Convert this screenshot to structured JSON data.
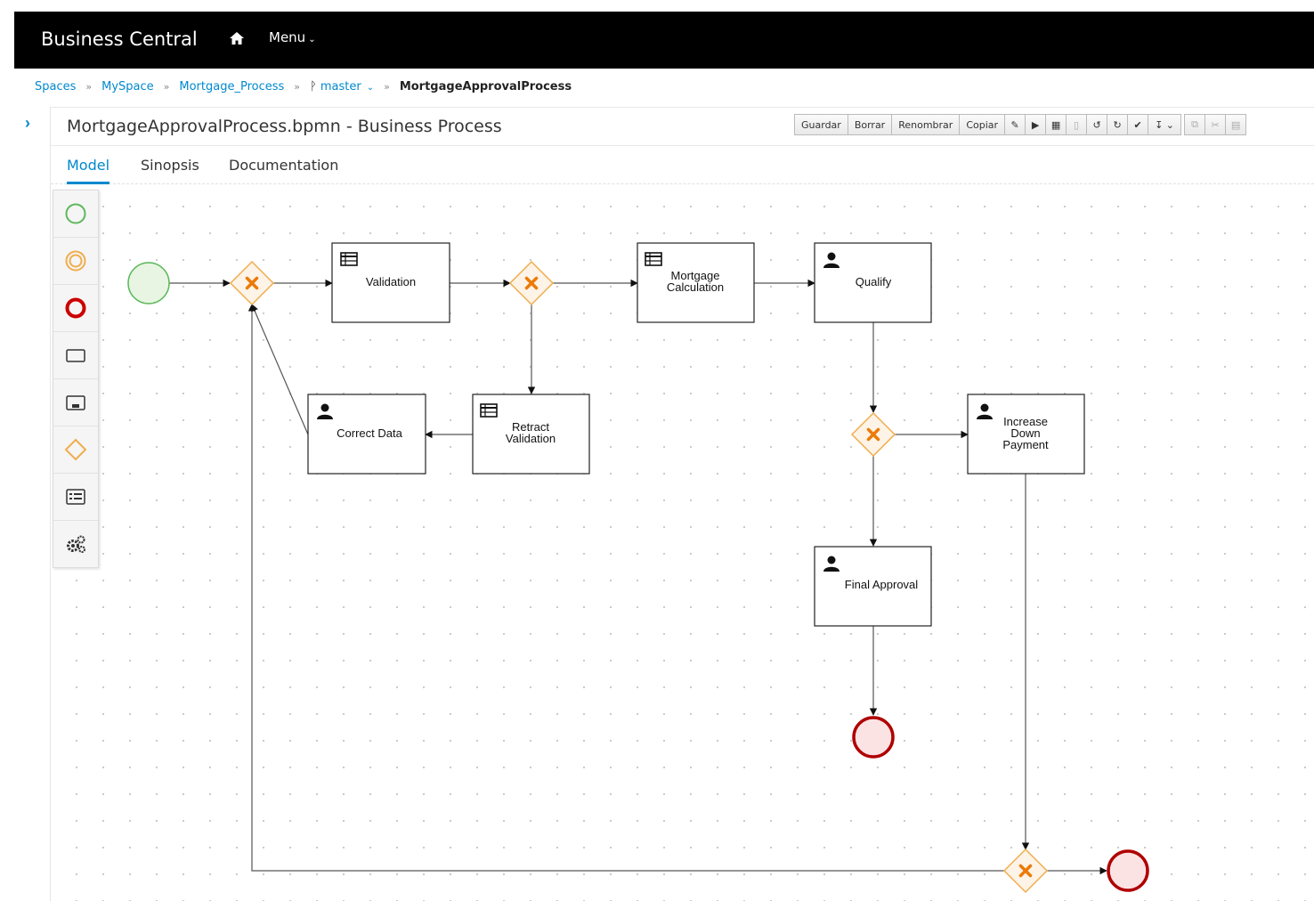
{
  "app": {
    "brand": "Business Central",
    "menu_label": "Menu"
  },
  "breadcrumb": {
    "items": [
      "Spaces",
      "MySpace",
      "Mortgage_Process"
    ],
    "branch": "master",
    "current": "MortgageApprovalProcess"
  },
  "editor": {
    "title": "MortgageApprovalProcess.bpmn - Business Process",
    "toolbar": {
      "save": "Guardar",
      "delete": "Borrar",
      "rename": "Renombrar",
      "copy": "Copiar"
    },
    "tabs": [
      "Model",
      "Sinopsis",
      "Documentation"
    ],
    "active_tab": "Model"
  },
  "palette": {
    "items": [
      "start-events",
      "intermediate-events",
      "end-events",
      "activities",
      "subprocesses",
      "gateways",
      "containers",
      "service-tasks"
    ]
  },
  "diagram": {
    "tasks": {
      "validation": {
        "lines": [
          "Validation"
        ],
        "kind": "business-rule"
      },
      "mortgage_calculation": {
        "lines": [
          "Mortgage",
          "Calculation"
        ],
        "kind": "business-rule"
      },
      "qualify": {
        "lines": [
          "Qualify"
        ],
        "kind": "user"
      },
      "correct_data": {
        "lines": [
          "Correct Data"
        ],
        "kind": "user"
      },
      "retract_validation": {
        "lines": [
          "Retract",
          "Validation"
        ],
        "kind": "business-rule"
      },
      "increase_down_payment": {
        "lines": [
          "Increase",
          "Down",
          "Payment"
        ],
        "kind": "user"
      },
      "final_approval": {
        "lines": [
          "Final Approval"
        ],
        "kind": "user"
      }
    },
    "colors": {
      "start_stroke": "#5cb85c",
      "start_fill": "#e8f5e2",
      "end_stroke": "#b00000",
      "end_fill": "#fbe3e4",
      "gateway_stroke": "#f0ad4e",
      "gateway_fill": "#fdf3e6",
      "gateway_x": "#ec7a08",
      "link": "#0088ce"
    }
  }
}
